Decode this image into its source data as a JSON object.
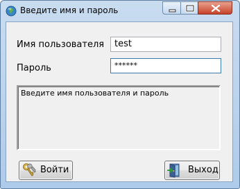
{
  "window": {
    "title": "Введите имя и пароль"
  },
  "form": {
    "username_label": "Имя пользователя",
    "username_value": "test",
    "password_label": "Пароль",
    "password_value": "******"
  },
  "status": {
    "message": "Введите имя пользователя и пароль"
  },
  "buttons": {
    "login_label": "Войти",
    "exit_label": "Выход"
  },
  "icons": {
    "app": "globe-icon",
    "login": "keys-icon",
    "exit": "exit-door-icon"
  },
  "colors": {
    "title_bar": "#c9dcf0",
    "close_button": "#c7432a",
    "client_background": "#f0f0f0"
  }
}
